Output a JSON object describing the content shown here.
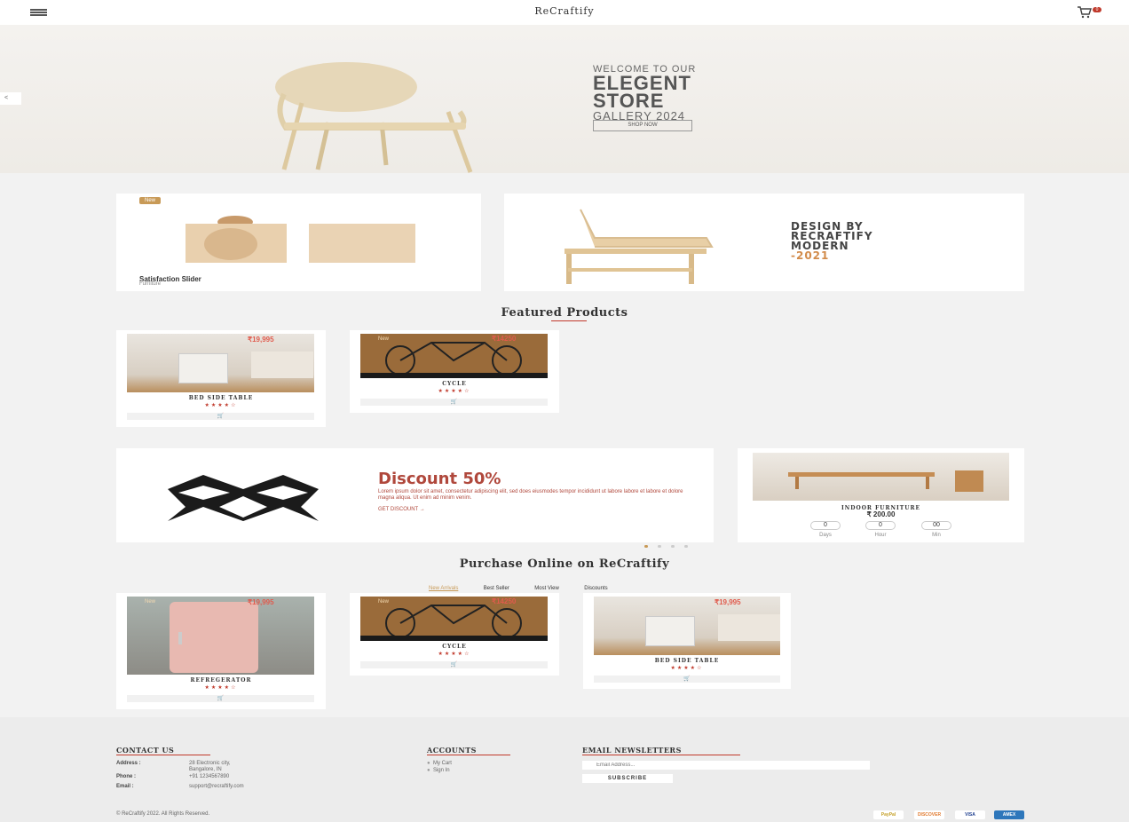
{
  "header": {
    "brand": "ReCraftify",
    "cart_count": "0"
  },
  "hero": {
    "line1": "WELCOME TO OUR",
    "line2": "ELEGENT",
    "line3": "STORE",
    "line4": "GALLERY 2024",
    "button": "SHOP NOW",
    "prev_arrow": "<"
  },
  "promo_left": {
    "badge": "New",
    "title": "Satisfaction Slider",
    "subtitle": "Furniture"
  },
  "promo_right": {
    "line1": "DESIGN BY",
    "line2": "RECRAFTIFY",
    "line3": "MODERN",
    "line4": "-2021"
  },
  "featured": {
    "title": "Featured Products",
    "products": [
      {
        "name": "BED SIDE TABLE",
        "stars": "★★★★☆",
        "price": "₹19,995"
      },
      {
        "name": "CYCLE",
        "badge": "New",
        "stars": "★★★★☆",
        "price": "₹14250"
      }
    ],
    "cart_icon": "🛒"
  },
  "discount": {
    "title": "Discount 50%",
    "text": "Lorem ipsum dolor sit amet, consectetur adipiscing elit, sed does eiusmodes tempor incididunt ut labore labore et labore et dolore magna aliqua. Ut enim ad minim venim.",
    "link": "GET DISCOUNT →"
  },
  "deal": {
    "name": "INDOOR FURNITURE",
    "price": "₹ 200.00",
    "countdown": [
      {
        "value": "0",
        "label": "Days"
      },
      {
        "value": "0",
        "label": "Hour"
      },
      {
        "value": "00",
        "label": "Min"
      }
    ]
  },
  "purchase": {
    "title": "Purchase Online on ReCraftify",
    "tabs": [
      "New Arrivals",
      "Best Seller",
      "Most View",
      "Discounts"
    ],
    "products": [
      {
        "name": "REFREGERATOR",
        "badge": "New",
        "stars": "★★★★☆",
        "price": "₹19,995"
      },
      {
        "name": "CYCLE",
        "badge": "New",
        "stars": "★★★★☆",
        "price": "₹14250"
      },
      {
        "name": "BED SIDE TABLE",
        "stars": "★★★★☆",
        "price": "₹19,995"
      }
    ]
  },
  "footer": {
    "contact_title": "CONTACT US",
    "address_label": "Address :",
    "address_line1": "28 Electronic city,",
    "address_line2": "Bangalore, IN",
    "phone_label": "Phone :",
    "phone": "+91 1234567890",
    "email_label": "Email :",
    "email": "support@recraftify.com",
    "accounts_title": "ACCOUNTS",
    "accounts_links": [
      "My Cart",
      "Sign In"
    ],
    "newsletter_title": "EMAIL NEWSLETTERS",
    "email_placeholder": "Email Address...",
    "subscribe": "SUBSCRIBE",
    "copyright": "© ReCraftify 2022. All Rights Reserved.",
    "payments": [
      "PayPal",
      "DISCOVER",
      "VISA",
      "AMEX"
    ]
  },
  "colors": {
    "accent_red": "#c0392b",
    "gold": "#c89a57",
    "background": "#f2f2f2"
  }
}
